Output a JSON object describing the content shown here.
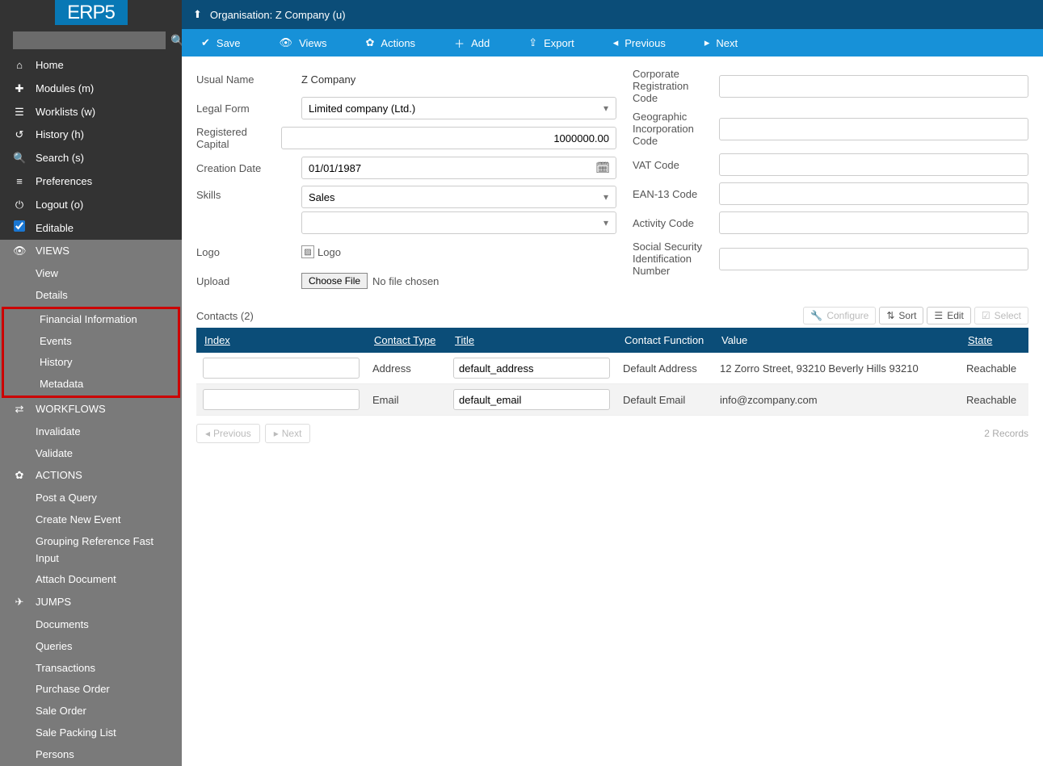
{
  "app_name": "ERP5",
  "search": {
    "placeholder": ""
  },
  "nav": [
    {
      "icon": "⌂",
      "label": "Home"
    },
    {
      "icon": "✚",
      "label": "Modules (m)"
    },
    {
      "icon": "☰",
      "label": "Worklists (w)"
    },
    {
      "icon": "↺",
      "label": "History (h)"
    },
    {
      "icon": "🔍",
      "label": "Search (s)"
    },
    {
      "icon": "≡",
      "label": "Preferences"
    },
    {
      "icon": "⏻",
      "label": "Logout (o)"
    }
  ],
  "editable_label": "Editable",
  "sections": {
    "views": {
      "header": "VIEWS",
      "icon": "👁",
      "items": [
        "View",
        "Details",
        "Financial Information",
        "Events",
        "History",
        "Metadata"
      ]
    },
    "workflows": {
      "header": "WORKFLOWS",
      "icon": "⇄",
      "items": [
        "Invalidate",
        "Validate"
      ]
    },
    "actions": {
      "header": "ACTIONS",
      "icon": "✿",
      "items": [
        "Post a Query",
        "Create New Event",
        "Grouping Reference Fast Input",
        "Attach Document"
      ]
    },
    "jumps": {
      "header": "JUMPS",
      "icon": "✈",
      "items": [
        "Documents",
        "Queries",
        "Transactions",
        "Purchase Order",
        "Sale Order",
        "Sale Packing List",
        "Persons"
      ]
    }
  },
  "breadcrumb": "Organisation: Z Company (u)",
  "toolbar": [
    {
      "icon": "✔",
      "label": "Save"
    },
    {
      "icon": "👁",
      "label": "Views"
    },
    {
      "icon": "✿",
      "label": "Actions"
    },
    {
      "icon": "＋",
      "label": "Add"
    },
    {
      "icon": "⇪",
      "label": "Export"
    },
    {
      "icon": "◂",
      "label": "Previous"
    },
    {
      "icon": "▸",
      "label": "Next"
    }
  ],
  "form": {
    "usual_name_label": "Usual Name",
    "usual_name_value": "Z Company",
    "legal_form_label": "Legal Form",
    "legal_form_value": "Limited company (Ltd.)",
    "registered_capital_label": "Registered Capital",
    "registered_capital_value": "1000000.00",
    "creation_date_label": "Creation Date",
    "creation_date_value": "01/01/1987",
    "skills_label": "Skills",
    "skills_value": "Sales",
    "skills_value2": "",
    "logo_label": "Logo",
    "logo_alt": "Logo",
    "upload_label": "Upload",
    "choose_file": "Choose File",
    "no_file": "No file chosen",
    "corp_reg_label": "Corporate Registration Code",
    "geo_inc_label": "Geographic Incorporation Code",
    "vat_label": "VAT Code",
    "ean_label": "EAN-13 Code",
    "activity_label": "Activity Code",
    "ssn_label": "Social Security Identification Number"
  },
  "contacts": {
    "title": "Contacts (2)",
    "controls": {
      "configure": "Configure",
      "sort": "Sort",
      "edit": "Edit",
      "select": "Select"
    },
    "columns": [
      "Index",
      "Contact Type",
      "Title",
      "Contact Function",
      "Value",
      "State"
    ],
    "rows": [
      {
        "index": "",
        "type": "Address",
        "title": "default_address",
        "func": "Default Address",
        "value": "12 Zorro Street, 93210 Beverly Hills 93210",
        "state": "Reachable"
      },
      {
        "index": "",
        "type": "Email",
        "title": "default_email",
        "func": "Default Email",
        "value": "info@zcompany.com",
        "state": "Reachable"
      }
    ],
    "pager": {
      "previous": "Previous",
      "next": "Next",
      "records": "2 Records"
    }
  }
}
